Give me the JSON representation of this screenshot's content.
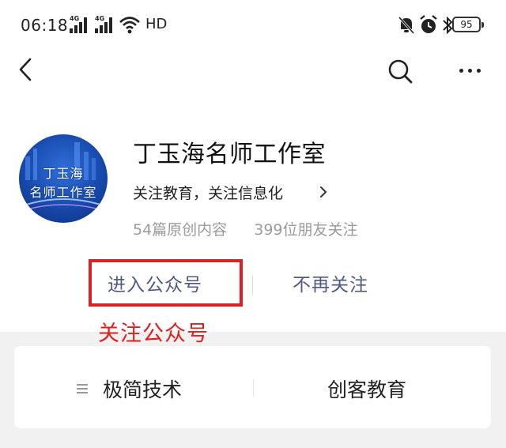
{
  "status_bar": {
    "time": "06:18",
    "network_1": "4G",
    "network_2": "4G",
    "hd_label": "HD",
    "battery": "95",
    "icons": [
      "mute-bell-icon",
      "alarm-icon",
      "bluetooth-icon"
    ]
  },
  "nav": {
    "back_icon": "chevron-left-icon",
    "search_icon": "search-icon",
    "more_icon": "more-dots-icon"
  },
  "profile": {
    "avatar_text_line1": "丁玉海",
    "avatar_text_line2": "名师工作室",
    "name": "丁玉海名师工作室",
    "description": "关注教育，关注信息化",
    "original_count": "54篇原创内容",
    "friends_following": "399位朋友关注"
  },
  "actions": {
    "enter_label": "进入公众号",
    "unfollow_label": "不再关注",
    "annotation": "关注公众号"
  },
  "colors": {
    "accent_text": "#4e5b80",
    "highlight": "#e02020",
    "muted": "#9a9a9a"
  },
  "menu": {
    "items": [
      {
        "label": "极简技术"
      },
      {
        "label": "创客教育"
      }
    ]
  }
}
